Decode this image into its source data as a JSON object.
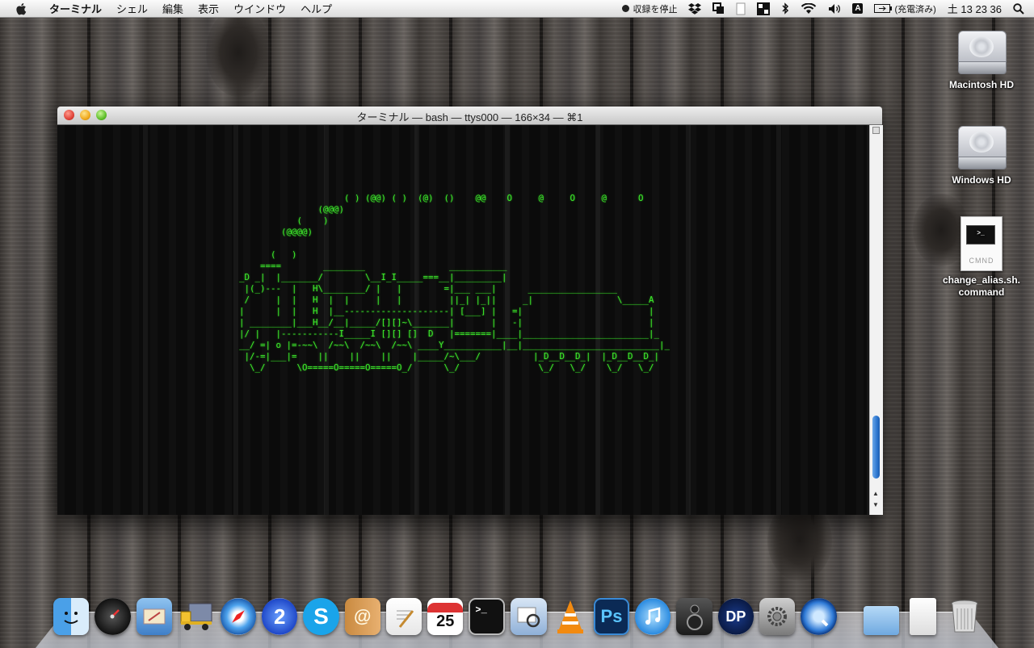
{
  "menubar": {
    "app": "ターミナル",
    "items": [
      "シェル",
      "編集",
      "表示",
      "ウインドウ",
      "ヘルプ"
    ],
    "recording": "収録を停止",
    "battery": "(充電済み)",
    "clock": "土 13 23 36",
    "input_badge": "A"
  },
  "desktop": {
    "icons": [
      {
        "label": "Macintosh HD",
        "icon": "hard-drive-icon"
      },
      {
        "label": "Windows HD",
        "icon": "hard-drive-icon"
      },
      {
        "label": "change_alias.sh.\ncommand",
        "icon": "terminal-document-icon",
        "doc_label": "CMND"
      }
    ]
  },
  "terminal": {
    "title": "ターミナル — bash — ttys000 — 166×34 — ⌘1",
    "text_color": "#3ded2b",
    "background": "#0b0b0b",
    "output": "                    ( ) (@@) ( )  (@)  ()    @@    O     @     O     @      O\n               (@@@)\n           (    )\n        (@@@@)\n\n      (   )\n    ====        ________                ___________\n_D _|  |_______/        \\__I_I_____===__|_________|\n |(_)---  |   H\\________/ |   |        =|___ ___|      _________________\n /     |  |   H  |  |     |   |         ||_| |_||     _|                \\_____A\n|      |  |   H  |__--------------------| [___] |   =|                        |\n| ________|___H__/__|_____/[][]~\\_______|       |   -|                        |\n|/ |   |-----------I_____I [][] []  D   |=======|____|________________________|_\n__/ =| o |=-~~\\  /~~\\  /~~\\  /~~\\ ____Y___________|__|__________________________|_\n |/-=|___|=    ||    ||    ||    |_____/~\\___/          |_D__D__D_|  |_D__D__D_|\n  \\_/      \\O=====O=====O=====O_/      \\_/               \\_/   \\_/    \\_/   \\_/"
  },
  "dock": {
    "items": [
      {
        "name": "Finder",
        "icon": "finder-icon"
      },
      {
        "name": "Dashboard",
        "icon": "dashboard-icon"
      },
      {
        "name": "Mail",
        "icon": "mail-icon"
      },
      {
        "name": "Transmit",
        "icon": "truck-icon"
      },
      {
        "name": "Safari",
        "icon": "safari-icon"
      },
      {
        "name": "Spaces",
        "icon": "spaces-icon",
        "badge": "2"
      },
      {
        "name": "Skype",
        "icon": "skype-icon"
      },
      {
        "name": "Address Book",
        "icon": "address-book-icon"
      },
      {
        "name": "TextEdit",
        "icon": "textedit-icon"
      },
      {
        "name": "iCal",
        "icon": "calendar-icon",
        "badge": "25"
      },
      {
        "name": "Terminal",
        "icon": "terminal-icon"
      },
      {
        "name": "Preview",
        "icon": "preview-icon"
      },
      {
        "name": "VLC",
        "icon": "vlc-icon"
      },
      {
        "name": "Photoshop",
        "icon": "photoshop-icon",
        "badge": "Ps"
      },
      {
        "name": "iTunes",
        "icon": "itunes-icon"
      },
      {
        "name": "Speaker",
        "icon": "speaker-icon"
      },
      {
        "name": "DP",
        "icon": "dp-icon",
        "badge": "DP"
      },
      {
        "name": "System Preferences",
        "icon": "system-preferences-icon"
      },
      {
        "name": "QuickTime",
        "icon": "quicktime-icon"
      },
      {
        "name": "Applications",
        "icon": "folder-icon"
      },
      {
        "name": "Documents",
        "icon": "document-stack-icon"
      },
      {
        "name": "Trash",
        "icon": "trash-icon"
      }
    ]
  }
}
